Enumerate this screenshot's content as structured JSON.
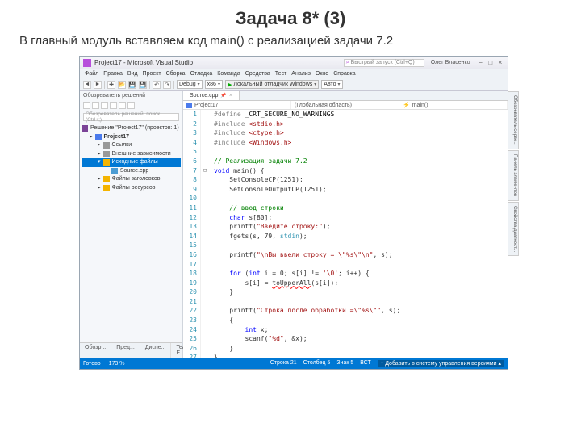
{
  "slide": {
    "title": "Задача 8* (3)",
    "subtitle": "В главный модуль вставляем код main() с реализацией задачи 7.2"
  },
  "titlebar": {
    "app": "Project17 - Microsoft Visual Studio",
    "search_placeholder": "Быстрый запуск (Ctrl+Q)",
    "user": "Олег Власенко"
  },
  "menu": [
    "Файл",
    "Правка",
    "Вид",
    "Проект",
    "Сборка",
    "Отладка",
    "Команда",
    "Средства",
    "Тест",
    "Анализ",
    "Окно",
    "Справка"
  ],
  "toolbar": {
    "config": "Debug",
    "platform": "x86",
    "run": "Локальный отладчик Windows",
    "auto": "Авто"
  },
  "solution": {
    "panel_title": "Обозреватель решений",
    "search_placeholder": "Обозреватель решений: поиск (Ctrl+;)",
    "root": "Решение \"Project17\" (проектов: 1)",
    "project": "Project17",
    "refs": "Ссылки",
    "ext": "Внешние зависимости",
    "src_folder": "Исходные файлы",
    "src_file": "Source.cpp",
    "hdr_folder": "Файлы заголовков",
    "res_folder": "Файлы ресурсов"
  },
  "editor": {
    "tab": "Source.cpp",
    "nav_project": "Project17",
    "nav_scope": "(Глобальная область)",
    "nav_func": "main()"
  },
  "code_lines": [
    {
      "n": 1,
      "fold": "",
      "html": "<span class='pp'>#define</span> <span class='id'>_CRT_SECURE_NO_WARNINGS</span>"
    },
    {
      "n": 2,
      "fold": "",
      "html": "<span class='inc'>#include</span> <span class='str'>&lt;stdio.h&gt;</span>"
    },
    {
      "n": 3,
      "fold": "",
      "html": "<span class='inc'>#include</span> <span class='str'>&lt;ctype.h&gt;</span>"
    },
    {
      "n": 4,
      "fold": "",
      "html": "<span class='inc'>#include</span> <span class='str'>&lt;Windows.h&gt;</span>"
    },
    {
      "n": 5,
      "fold": "",
      "html": ""
    },
    {
      "n": 6,
      "fold": "",
      "html": "<span class='cmt'>// Реализация задачи 7.2</span>"
    },
    {
      "n": 7,
      "fold": "⊟",
      "html": "<span class='kw'>void</span> main() {"
    },
    {
      "n": 8,
      "fold": "",
      "html": "    SetConsoleCP(1251);"
    },
    {
      "n": 9,
      "fold": "",
      "html": "    SetConsoleOutputCP(1251);"
    },
    {
      "n": 10,
      "fold": "",
      "html": ""
    },
    {
      "n": 11,
      "fold": "",
      "html": "    <span class='cmt'>// ввод строки</span>"
    },
    {
      "n": 12,
      "fold": "",
      "html": "    <span class='kw'>char</span> s[80];"
    },
    {
      "n": 13,
      "fold": "",
      "html": "    printf(<span class='str'>\"Введите строку:\"</span>);"
    },
    {
      "n": 14,
      "fold": "",
      "html": "    fgets(s, 79, <span class='typ'>stdin</span>);"
    },
    {
      "n": 15,
      "fold": "",
      "html": ""
    },
    {
      "n": 16,
      "fold": "",
      "html": "    printf(<span class='str'>\"\\nВы ввели строку = \\\"%s\\\"\\n\"</span>, s);"
    },
    {
      "n": 17,
      "fold": "",
      "html": ""
    },
    {
      "n": 18,
      "fold": "",
      "html": "    <span class='kw'>for</span> (<span class='kw'>int</span> i = 0; s[i] != <span class='str'>'\\0'</span>; i++) {"
    },
    {
      "n": 19,
      "fold": "",
      "html": "        s[i] = <span style='text-decoration:underline wavy red'>toUpperAll</span>(s[i]);"
    },
    {
      "n": 20,
      "fold": "",
      "html": "    }"
    },
    {
      "n": 21,
      "fold": "",
      "html": ""
    },
    {
      "n": 22,
      "fold": "",
      "html": "    printf(<span class='str'>\"Строка после обработки =\\\"%s\\\"\"</span>, s);"
    },
    {
      "n": 23,
      "fold": "",
      "html": "    {"
    },
    {
      "n": 24,
      "fold": "",
      "html": "        <span class='kw'>int</span> x;"
    },
    {
      "n": 25,
      "fold": "",
      "html": "        scanf(<span class='str'>\"%d\"</span>, &amp;x);"
    },
    {
      "n": 26,
      "fold": "",
      "html": "    }"
    },
    {
      "n": 27,
      "fold": "",
      "html": "}"
    }
  ],
  "bottom_tabs": [
    "Обозр...",
    "Пред...",
    "Диспе...",
    "Team E..."
  ],
  "right_tabs": [
    "Обозреватель серве...",
    "Панель элементов",
    "Свойства диагност..."
  ],
  "status": {
    "ready": "Готово",
    "zoom": "173 %",
    "line": "Строка 21",
    "col": "Столбец 5",
    "ch": "Знак 5",
    "ins": "ВСТ",
    "git": "Добавить в систему управления версиями"
  }
}
